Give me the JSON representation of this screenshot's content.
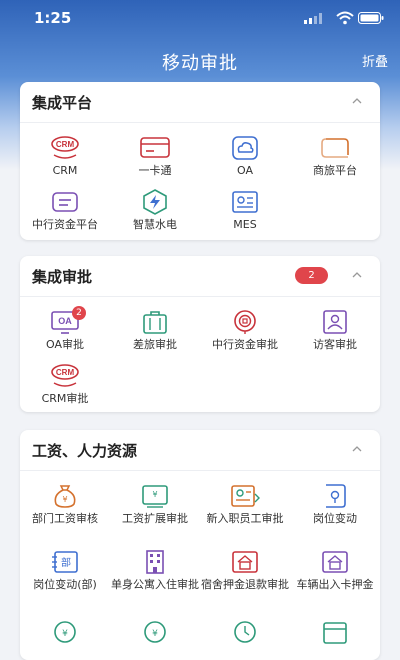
{
  "status": {
    "time": "1:25"
  },
  "nav": {
    "title": "移动审批",
    "fold": "折叠"
  },
  "sections": {
    "platform": {
      "title": "集成平台",
      "items": [
        "CRM",
        "一卡通",
        "OA",
        "商旅平台",
        "中行资金平台",
        "智慧水电",
        "MES"
      ]
    },
    "approval": {
      "title": "集成审批",
      "badge": "2",
      "item_badge": "2",
      "items": [
        "OA审批",
        "差旅审批",
        "中行资金审批",
        "访客审批",
        "CRM审批"
      ]
    },
    "hr": {
      "title": "工资、人力资源",
      "items": [
        "部门工资审核",
        "工资扩展审批",
        "新入职员工审批",
        "岗位变动",
        "岗位变动(部)",
        "单身公寓入住审批",
        "宿舍押金退款审批",
        "车辆出入卡押金"
      ]
    }
  },
  "icon_text": {
    "crm": "CRM",
    "oa": "OA",
    "bu": "部"
  },
  "colors": {
    "accent": "#2f63b8",
    "red": "#c8333b",
    "green": "#2e9a7a",
    "blue": "#3f6fd0",
    "purple": "#7a4fb3",
    "orange": "#d4712d"
  }
}
